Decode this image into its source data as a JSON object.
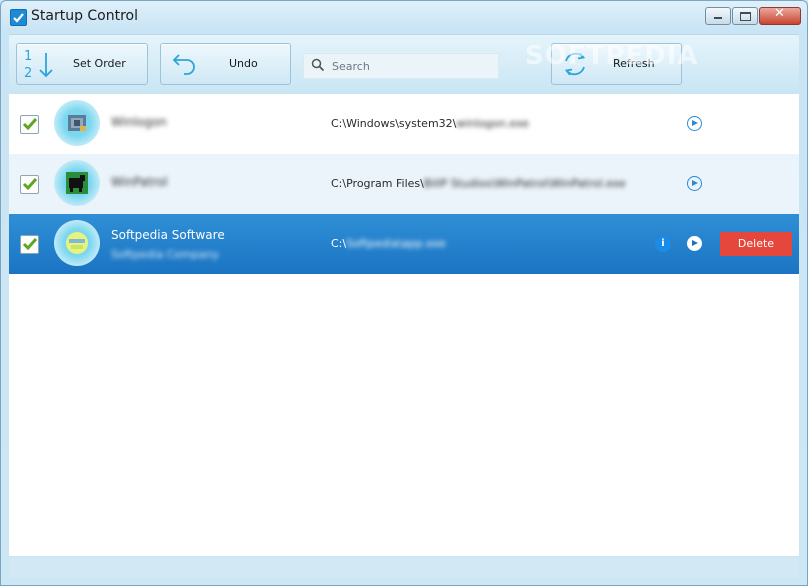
{
  "window": {
    "title": "Startup Control"
  },
  "toolbar": {
    "set_order_label": "Set Order",
    "undo_label": "Undo",
    "refresh_label": "Refresh",
    "search_placeholder": "Search",
    "watermark": "SOFTPEDIA"
  },
  "items": [
    {
      "name": "Winlogon",
      "path_prefix": "C:\\Windows\\system32\\",
      "path_rest": "winlogon.exe",
      "checked": true,
      "icon": "gear-app-icon"
    },
    {
      "name": "WinPatrol",
      "path_prefix": "C:\\Program Files\\",
      "path_rest": "BillP Studios\\WinPatrol\\WinPatrol.exe",
      "checked": true,
      "icon": "dog-app-icon"
    },
    {
      "name": "Softpedia Software",
      "subtitle": "Softpedia Company",
      "path_prefix": "C:\\",
      "path_rest": "Softpedia\\app.exe",
      "checked": true,
      "icon": "softpedia-app-icon",
      "selected": true,
      "delete_label": "Delete",
      "info_label": "i"
    }
  ],
  "colors": {
    "accent": "#1b74c3",
    "delete": "#e5473c",
    "check": "#5ea61f"
  }
}
